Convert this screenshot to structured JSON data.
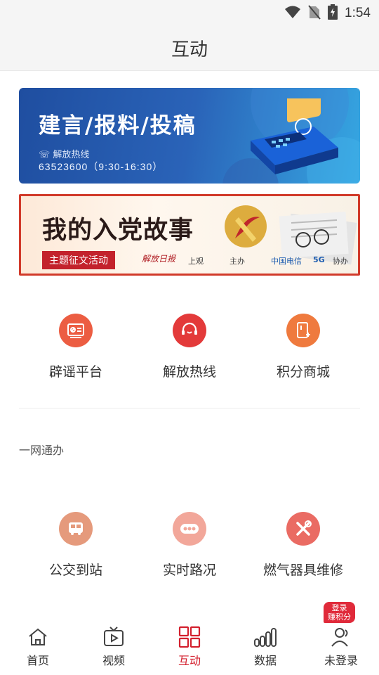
{
  "status": {
    "time": "1:54"
  },
  "header": {
    "title": "互动"
  },
  "banner1": {
    "title": "建言/报料/投稿",
    "hotline_label": "解放热线",
    "phone": "63523600（9:30-16:30）"
  },
  "banner2": {
    "title": "我的入党故事",
    "tag": "主题征文活动",
    "sponsor_text": "解放日报",
    "sponsor_note": "主办",
    "co_note": "协办",
    "co_sponsor": "中国电信",
    "co_5g": "5G",
    "shangguan": "上观"
  },
  "services_top": [
    {
      "label": "辟谣平台",
      "icon": "rumor-icon",
      "color": "#ec5d42"
    },
    {
      "label": "解放热线",
      "icon": "headset-icon",
      "color": "#e33a3a"
    },
    {
      "label": "积分商城",
      "icon": "shop-icon",
      "color": "#ef7a3e"
    }
  ],
  "section": {
    "title": "一网通办"
  },
  "services_bottom": [
    {
      "label": "公交到站",
      "icon": "bus-icon",
      "color": "#e59a7c"
    },
    {
      "label": "实时路况",
      "icon": "traffic-icon",
      "color": "#f2a79a"
    },
    {
      "label": "燃气器具维修",
      "icon": "repair-icon",
      "color": "#ea6b63"
    }
  ],
  "tabs": [
    {
      "label": "首页",
      "icon": "home-icon"
    },
    {
      "label": "视频",
      "icon": "tv-icon"
    },
    {
      "label": "互动",
      "icon": "grid-icon"
    },
    {
      "label": "数据",
      "icon": "bar-chart-icon"
    },
    {
      "label": "未登录",
      "icon": "user-icon"
    }
  ],
  "login_badge": {
    "line1": "登录",
    "line2": "赚积分"
  },
  "colors": {
    "accent": "#d3202e",
    "banner_blue": "#2a63b8"
  }
}
